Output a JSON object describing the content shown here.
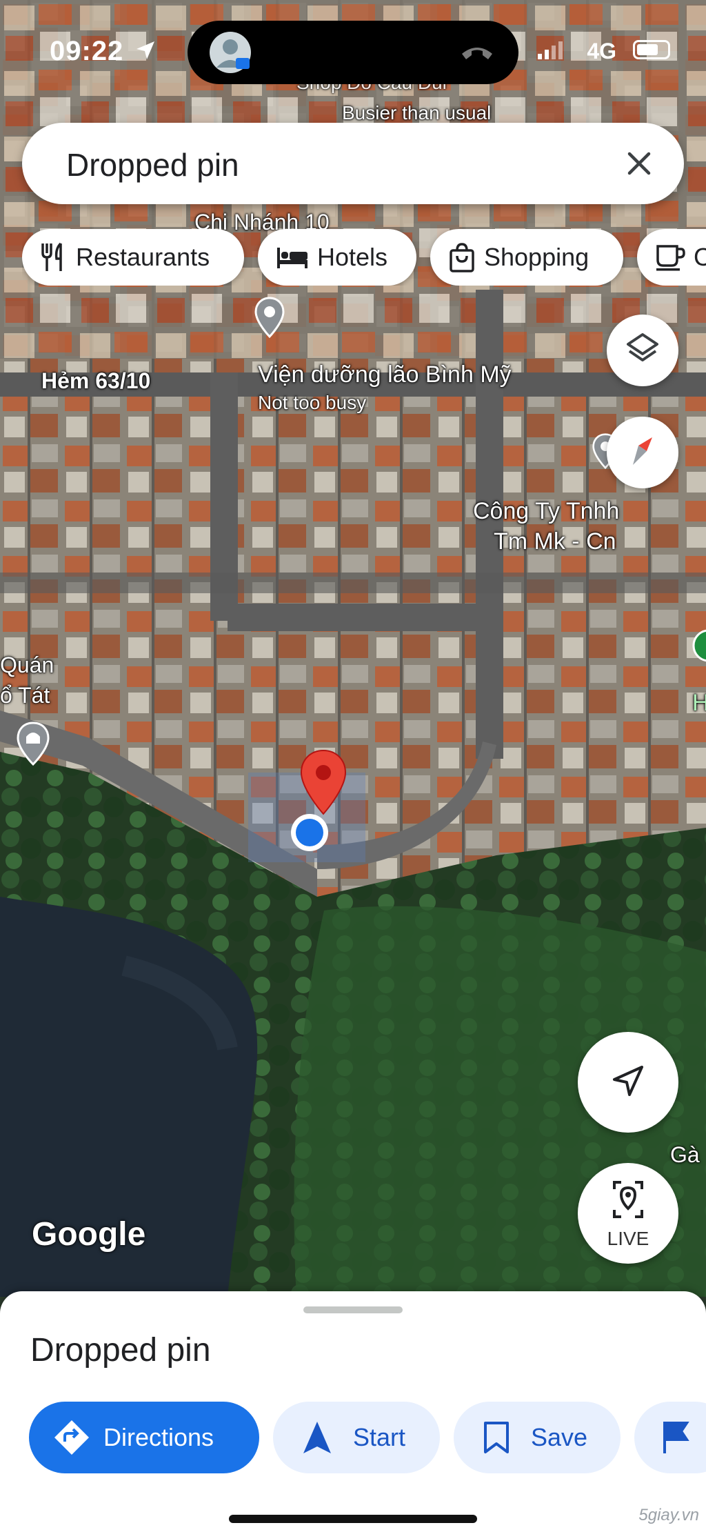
{
  "status": {
    "time": "09:22",
    "network": "4G"
  },
  "search": {
    "title": "Dropped pin"
  },
  "chips": [
    {
      "label": "Restaurants",
      "icon": "restaurant-icon"
    },
    {
      "label": "Hotels",
      "icon": "bed-icon"
    },
    {
      "label": "Shopping",
      "icon": "shopping-bag-icon"
    },
    {
      "label": "C",
      "icon": "coffee-icon"
    }
  ],
  "map_labels": {
    "top_place": "Shop Đồ Cầu Đui",
    "top_place_status": "Busier than usual",
    "branch": "Chi Nhánh 10",
    "alley": "Hẻm 63/10",
    "poi_name": "Viện dưỡng lão Bình Mỹ",
    "poi_status": "Not too busy",
    "company_line1": "Công Ty Tnhh",
    "company_line2": "Tm Mk - Cn",
    "left_line1": "Quán",
    "left_line2": "ổ Tát",
    "right_edge": "H",
    "right_edge2": "Gà",
    "google": "Google"
  },
  "fab": {
    "live_label": "LIVE"
  },
  "sheet": {
    "title": "Dropped pin",
    "actions": [
      {
        "label": "Directions",
        "icon": "directions-icon",
        "style": "primary"
      },
      {
        "label": "Start",
        "icon": "navigation-arrow-icon",
        "style": "secondary"
      },
      {
        "label": "Save",
        "icon": "bookmark-icon",
        "style": "secondary"
      }
    ]
  },
  "watermark": "5giay.vn",
  "colors": {
    "accent": "#1a73e8",
    "pin": "#ea4335",
    "location_dot": "#1a73e8",
    "secondary_button_bg": "#e8f0fe"
  }
}
